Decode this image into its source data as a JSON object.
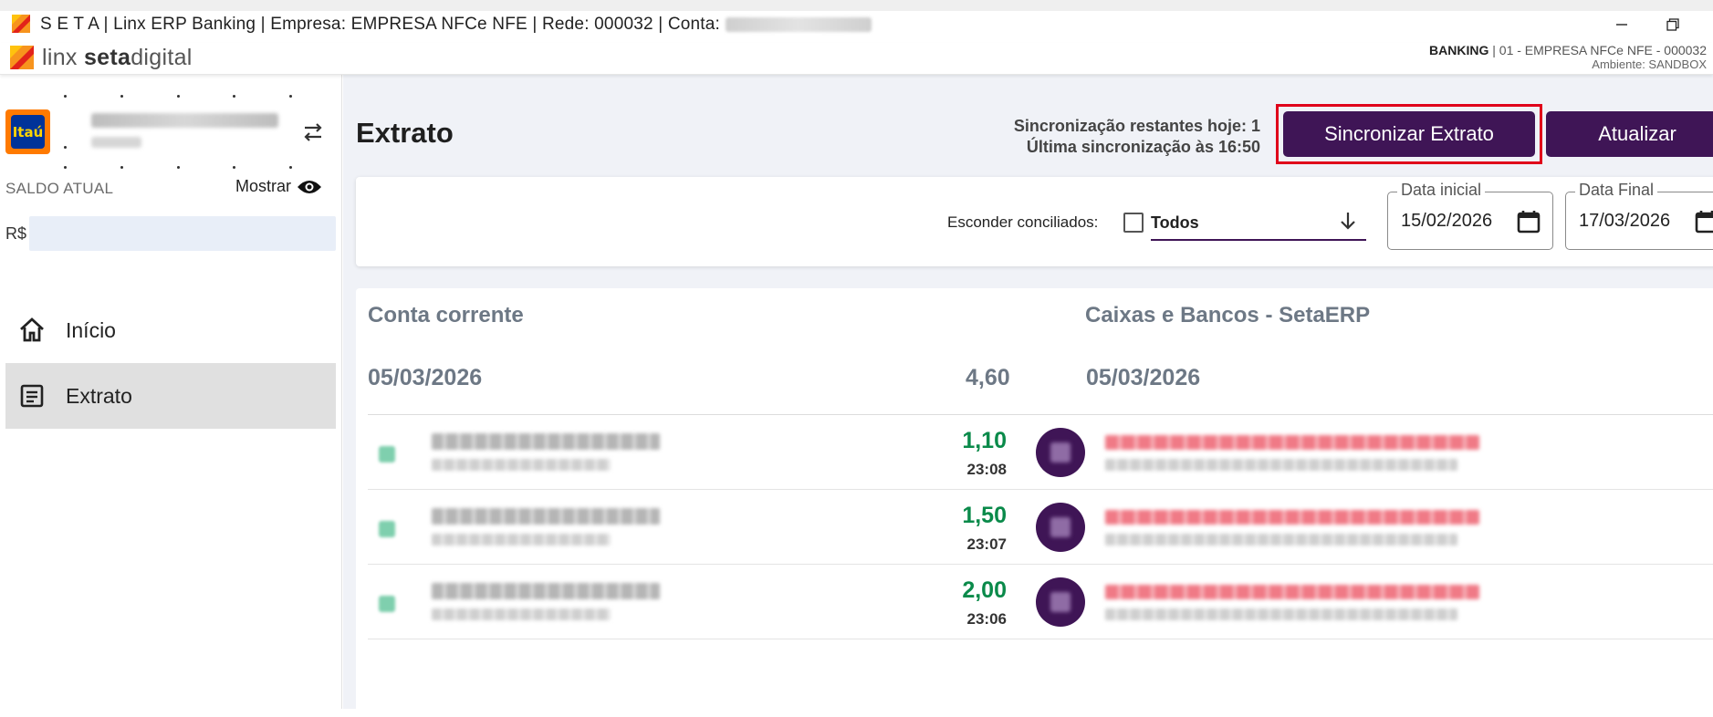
{
  "window": {
    "title_prefix": "S E T A | Linx ERP Banking | Empresa: EMPRESA NFCe NFE | Rede: 000032 | Conta: ",
    "title_redacted": "ITAU RENAN TESTE"
  },
  "brand": {
    "logo_light": "linx ",
    "logo_bold": "seta",
    "logo_tail": "digital",
    "banking_label": "BANKING",
    "company_info": "01 - EMPRESA NFCe NFE - 000032",
    "environment": "Ambiente: SANDBOX"
  },
  "sidebar": {
    "bank_logo_text": "Itaú",
    "account_name_redacted": "ITAU RENAN TESTE",
    "account_sub_redacted": "CNPJ",
    "saldo_label": "SALDO ATUAL",
    "mostrar_label": "Mostrar",
    "currency": "R$",
    "nav": [
      {
        "label": "Início",
        "icon": "home-icon",
        "active": false
      },
      {
        "label": "Extrato",
        "icon": "document-icon",
        "active": true
      }
    ]
  },
  "header": {
    "title": "Extrato",
    "sync_remaining": "Sincronização restantes hoje: 1",
    "last_sync": "Última sincronização às 16:50",
    "sync_button": "Sincronizar Extrato",
    "refresh_button": "Atualizar"
  },
  "filters": {
    "hide_reconciled_label": "Esconder conciliados:",
    "hide_reconciled_checked": false,
    "status_select": "Todos",
    "start_date_label": "Data inicial",
    "start_date": "15/02/2026",
    "end_date_label": "Data Final",
    "end_date": "17/03/2026"
  },
  "statement": {
    "left_title": "Conta corrente",
    "right_title": "Caixas e Bancos - SetaERP",
    "group_date_left": "05/03/2026",
    "group_date_right": "05/03/2026",
    "group_total": "4,60",
    "transactions": [
      {
        "amount": "1,10",
        "time": "23:08"
      },
      {
        "amount": "1,50",
        "time": "23:07"
      },
      {
        "amount": "2,00",
        "time": "23:06"
      }
    ]
  },
  "colors": {
    "primary": "#3f1556",
    "highlight": "#e0001a",
    "positive": "#0a8a4a",
    "muted_heading": "#6d7885"
  }
}
